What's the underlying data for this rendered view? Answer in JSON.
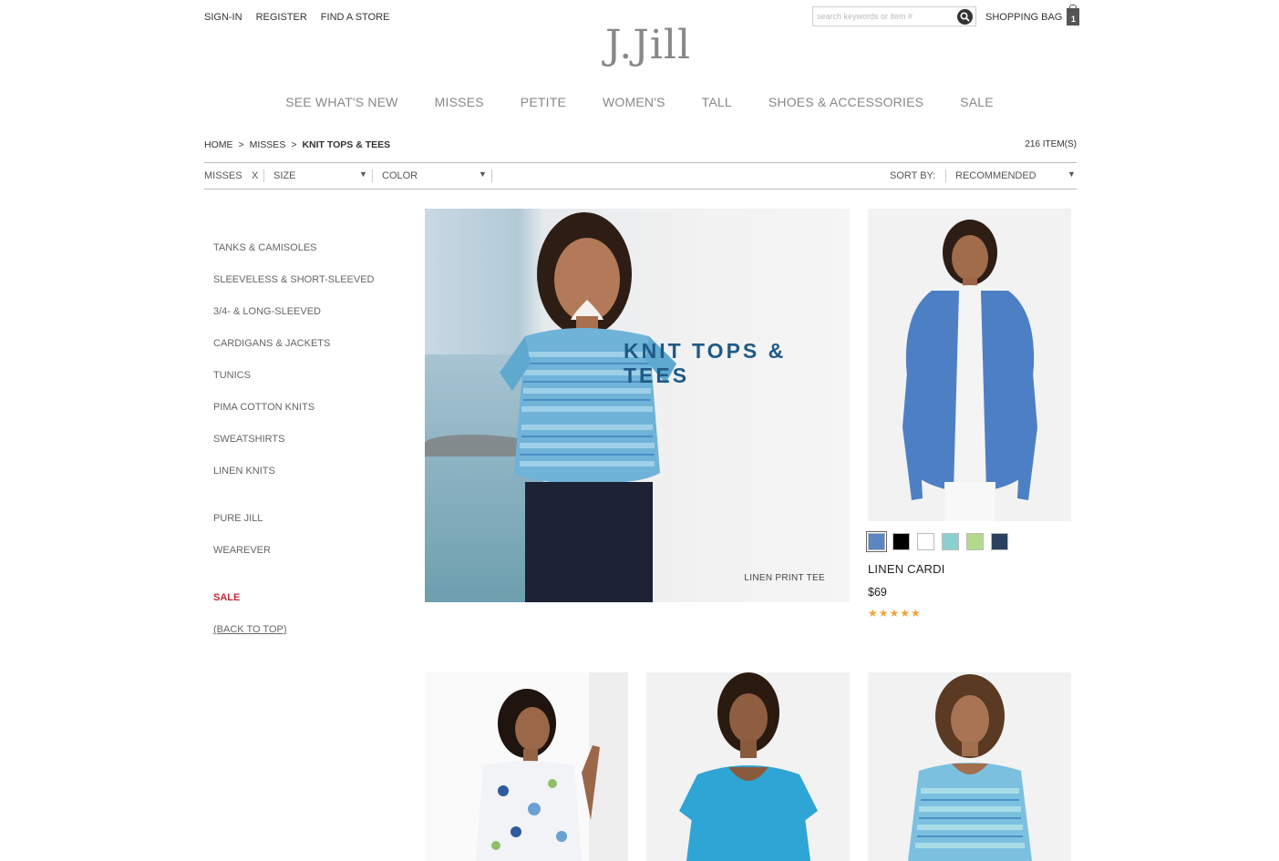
{
  "header": {
    "util_links": [
      "SIGN-IN",
      "REGISTER",
      "FIND A STORE"
    ],
    "search_placeholder": "search keywords or item #",
    "bag_label": "SHOPPING BAG",
    "bag_count": "1",
    "logo": "J.Jill"
  },
  "nav": [
    "SEE WHAT'S NEW",
    "MISSES",
    "PETITE",
    "WOMEN'S",
    "TALL",
    "SHOES & ACCESSORIES",
    "SALE"
  ],
  "breadcrumb": {
    "home": "HOME",
    "sep": ">",
    "parent": "MISSES",
    "current": "KNIT TOPS & TEES"
  },
  "item_count": "216 ITEM(S)",
  "filters": {
    "misses": "MISSES",
    "remove": "X",
    "size": "SIZE",
    "color": "COLOR",
    "sort_label": "SORT BY:",
    "sort_value": "RECOMMENDED",
    "caret": "▼"
  },
  "sidebar": {
    "categories": [
      "TANKS & CAMISOLES",
      "SLEEVELESS & SHORT-SLEEVED",
      "3/4- & LONG-SLEEVED",
      "CARDIGANS & JACKETS",
      "TUNICS",
      "PIMA COTTON KNITS",
      "SWEATSHIRTS",
      "LINEN KNITS"
    ],
    "collections": [
      "PURE JILL",
      "WEAREVER"
    ],
    "sale": "SALE",
    "back_to_top": "(BACK TO TOP)"
  },
  "hero": {
    "title": "KNIT TOPS & TEES",
    "caption": "LINEN PRINT TEE"
  },
  "product": {
    "name": "LINEN CARDI",
    "price": "$69",
    "rating": 5,
    "stars": "★★★★★",
    "swatch_colors": [
      "#5b86c4",
      "#000000",
      "#ffffff",
      "#8ccfcf",
      "#b3d98c",
      "#2b3f5e"
    ]
  },
  "colors": {
    "accent": "#1f5a86",
    "sale": "#c4283c",
    "star": "#f2a23a"
  }
}
